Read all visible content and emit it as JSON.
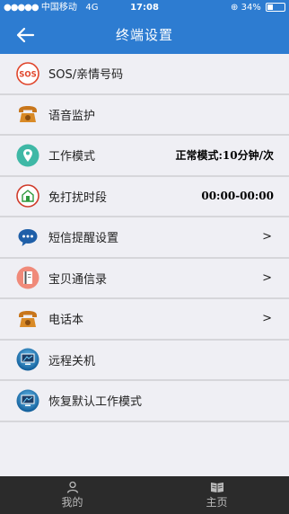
{
  "statusbar": {
    "carrier": "中国移动",
    "network": "4G",
    "time": "17:08",
    "battery": "34%",
    "battery_level": 0.34
  },
  "header": {
    "title": "终端设置"
  },
  "settings": [
    {
      "label": "SOS/亲情号码",
      "icon": "sos-icon",
      "icon_text": "SOS",
      "value": "",
      "arrow": ""
    },
    {
      "label": "语音监护",
      "icon": "telephone-icon",
      "value": "",
      "arrow": ""
    },
    {
      "label": "工作模式",
      "icon": "location-pin-icon",
      "value": "正常模式:10分钟/次",
      "arrow": ""
    },
    {
      "label": "免打扰时段",
      "icon": "do-not-disturb-icon",
      "value": "00:00-00:00",
      "arrow": ""
    },
    {
      "label": "短信提醒设置",
      "icon": "message-bubble-icon",
      "value": "",
      "arrow": ">"
    },
    {
      "label": "宝贝通信录",
      "icon": "address-book-icon",
      "value": "",
      "arrow": ">"
    },
    {
      "label": "电话本",
      "icon": "telephone-icon",
      "value": "",
      "arrow": ">"
    },
    {
      "label": "远程关机",
      "icon": "monitor-icon",
      "value": "",
      "arrow": ""
    },
    {
      "label": "恢复默认工作模式",
      "icon": "monitor-icon",
      "value": "",
      "arrow": ""
    }
  ],
  "tabbar": {
    "tabs": [
      {
        "label": "我的",
        "icon": "person-icon"
      },
      {
        "label": "主页",
        "icon": "book-icon"
      }
    ]
  },
  "colors": {
    "header": "#2d7cd1",
    "background": "#efeff4",
    "tabbar": "#2b2b2b"
  }
}
